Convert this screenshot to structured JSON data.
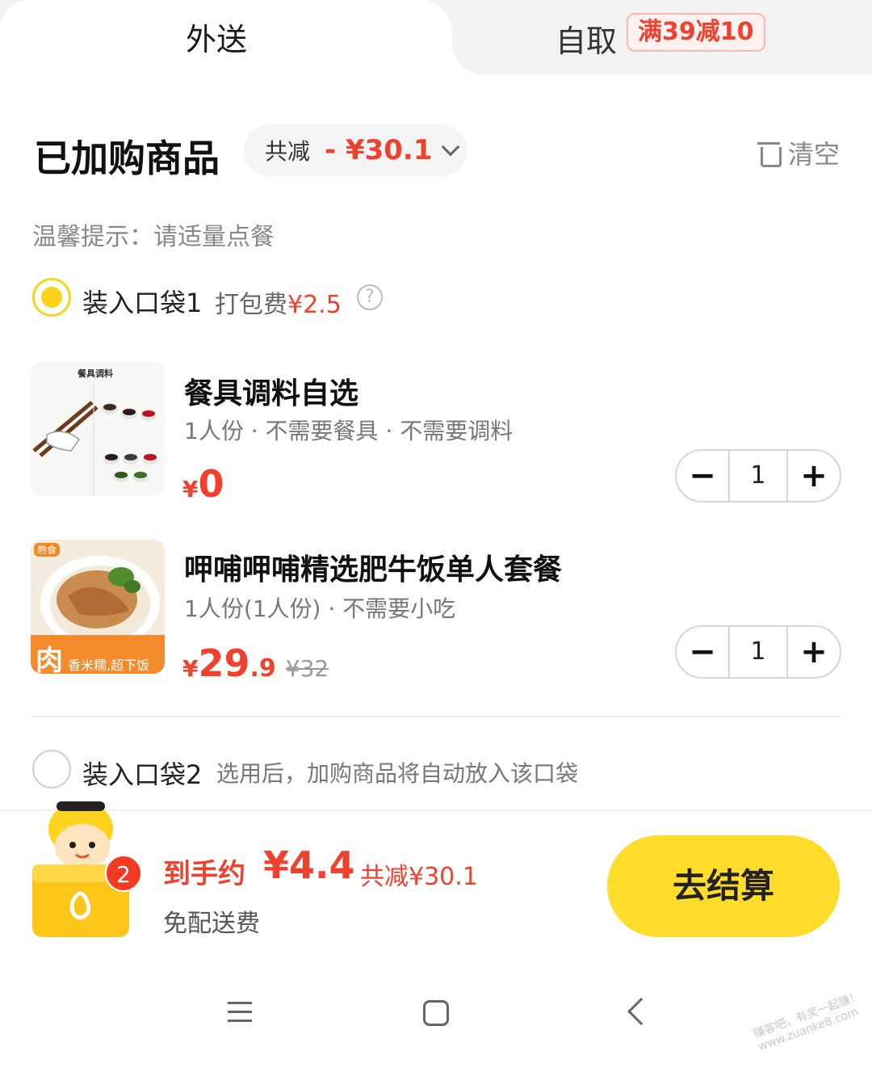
{
  "tabs": {
    "delivery": "外送",
    "pickup": "自取",
    "pickup_badge": "满39减10"
  },
  "header": {
    "title": "已加购商品",
    "discount_label": "共减",
    "discount_value": "- ¥30.1",
    "clear_label": "清空"
  },
  "tip": "温馨提示：请适量点餐",
  "bag1": {
    "label": "装入口袋1",
    "fee_label": "打包费",
    "fee_value": "¥2.5",
    "help": "?"
  },
  "items": [
    {
      "name": "餐具调料自选",
      "spec": "1人份 · 不需要餐具 · 不需要调料",
      "price_yen": "¥",
      "price_int": "0",
      "price_dec": "",
      "orig_price": "",
      "qty": "1",
      "thumb_label": "餐具调料"
    },
    {
      "name": "呷哺呷哺精选肥牛饭单人套餐",
      "spec": "1人份(1人份) · 不需要小吃",
      "price_yen": "¥",
      "price_int": "29",
      "price_dec": ".9",
      "orig_price": "¥32",
      "qty": "1",
      "thumb_tag": "熟食",
      "thumb_label": "肉",
      "thumb_sub": "香米糯,超下饭"
    }
  ],
  "stepper": {
    "minus": "−",
    "plus": "+"
  },
  "bag2": {
    "label": "装入口袋2",
    "note": "选用后，加购商品将自动放入该口袋"
  },
  "summary": {
    "count": "2",
    "total_label": "到手约",
    "total_value": "¥4.4",
    "total_discount": "共减¥30.1",
    "free_shipping": "免配送费",
    "checkout": "去结算"
  },
  "watermark": "赚客吧，有奖一起赚！ www.zuanke8.com",
  "colors": {
    "accent": "#ffdd2a",
    "price": "#f0412e"
  }
}
